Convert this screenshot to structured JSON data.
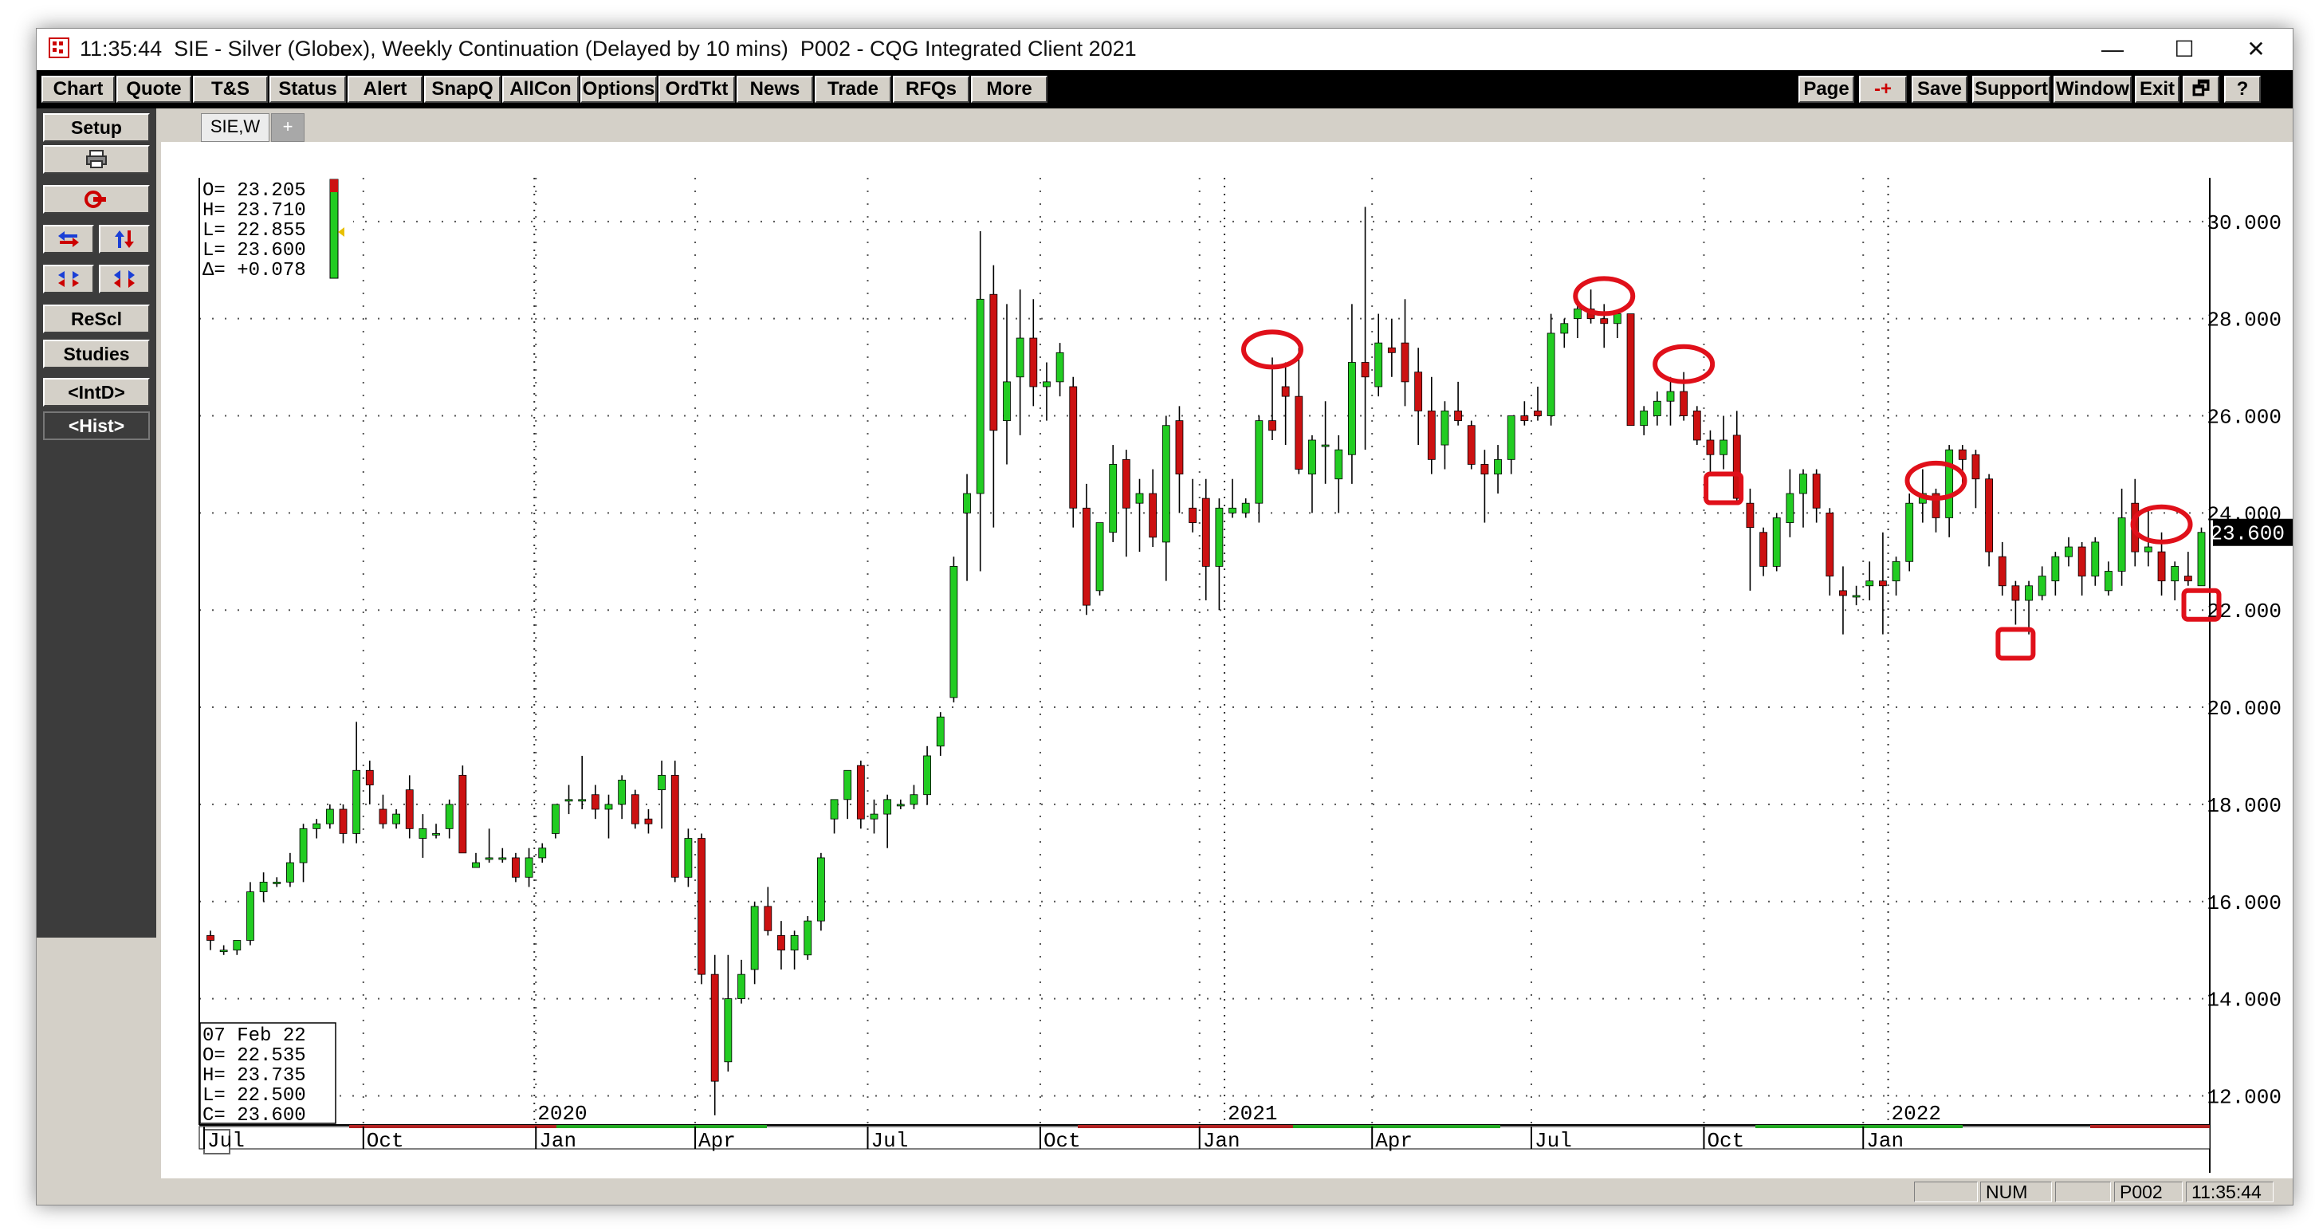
{
  "window": {
    "title": "11:35:44  SIE - Silver (Globex), Weekly Continuation (Delayed by 10 mins)  P002 - CQG Integrated Client 2021",
    "minimize": "—",
    "maximize": "☐",
    "close": "✕"
  },
  "menu_left": [
    "Chart",
    "Quote",
    "T&S",
    "Status",
    "Alert",
    "SnapQ",
    "AllCon",
    "Options",
    "OrdTkt",
    "News",
    "Trade",
    "RFQs",
    "More"
  ],
  "menu_right": [
    "Page",
    "-+",
    "Save",
    "Support",
    "Window",
    "Exit",
    "🗗",
    "?"
  ],
  "sidebar": {
    "setup": "Setup",
    "print_icon": "printer-icon",
    "close_chart_icon": "close-chart-icon",
    "rescale": "ReScl",
    "studies": "Studies",
    "intd": "<IntD>",
    "hist": "<Hist>"
  },
  "tabs": {
    "active": "SIE,W",
    "add": "+"
  },
  "colors": {
    "up": "#22cc22",
    "down": "#cc1111",
    "circle": "#e0101a",
    "grid": "#555555"
  },
  "readout_top": [
    "O=  23.205",
    "H=  23.710",
    "L=  22.855",
    "L=  23.600",
    "Δ= +0.078"
  ],
  "readout_bottom": [
    "07 Feb 22",
    "O=   22.535",
    "H=   23.735",
    "L=   22.500",
    "C=   23.600"
  ],
  "price_tag": "23.600",
  "status": {
    "num": "NUM",
    "page": "P002",
    "time": "11:35:44"
  },
  "chart_data": {
    "type": "candlestick",
    "title": "SIE - Silver (Globex), Weekly Continuation",
    "x_labels": [
      {
        "w": 0,
        "label": "Jul"
      },
      {
        "w": 12,
        "label": "Oct"
      },
      {
        "w": 25,
        "label": "Jan"
      },
      {
        "w": 37,
        "label": "Apr"
      },
      {
        "w": 50,
        "label": "Jul"
      },
      {
        "w": 63,
        "label": "Oct"
      },
      {
        "w": 75,
        "label": "Jan"
      },
      {
        "w": 88,
        "label": "Apr"
      },
      {
        "w": 100,
        "label": "Jul"
      },
      {
        "w": 113,
        "label": "Oct"
      },
      {
        "w": 125,
        "label": "Jan"
      }
    ],
    "year_labels": [
      {
        "w": 25,
        "label": "2020"
      },
      {
        "w": 77,
        "label": "2021"
      },
      {
        "w": 127,
        "label": "2022"
      }
    ],
    "y_ticks": [
      "12.000",
      "14.000",
      "16.000",
      "18.000",
      "20.000",
      "22.000",
      "24.000",
      "26.000",
      "28.000",
      "30.000"
    ],
    "ylim": [
      11.4,
      30.9
    ],
    "candles": [
      [
        15.3,
        15.4,
        15.0,
        15.2
      ],
      [
        15.0,
        15.1,
        14.9,
        15.0
      ],
      [
        15.0,
        15.2,
        14.9,
        15.2
      ],
      [
        15.2,
        16.4,
        15.1,
        16.2
      ],
      [
        16.2,
        16.6,
        16.0,
        16.4
      ],
      [
        16.4,
        16.5,
        16.3,
        16.4
      ],
      [
        16.4,
        17.0,
        16.3,
        16.8
      ],
      [
        16.8,
        17.6,
        16.4,
        17.5
      ],
      [
        17.5,
        17.7,
        17.3,
        17.6
      ],
      [
        17.6,
        18.0,
        17.5,
        17.9
      ],
      [
        17.9,
        18.0,
        17.2,
        17.4
      ],
      [
        17.4,
        19.7,
        17.2,
        18.7
      ],
      [
        18.7,
        18.9,
        18.0,
        18.4
      ],
      [
        17.9,
        18.2,
        17.5,
        17.6
      ],
      [
        17.6,
        17.9,
        17.5,
        17.8
      ],
      [
        18.3,
        18.6,
        17.3,
        17.5
      ],
      [
        17.3,
        17.8,
        16.9,
        17.5
      ],
      [
        17.4,
        17.6,
        17.3,
        17.4
      ],
      [
        17.5,
        18.1,
        17.3,
        18.0
      ],
      [
        18.6,
        18.8,
        17.0,
        17.0
      ],
      [
        16.7,
        17.0,
        16.7,
        16.8
      ],
      [
        16.9,
        17.5,
        16.8,
        16.9
      ],
      [
        16.9,
        17.1,
        16.8,
        16.9
      ],
      [
        16.9,
        17.0,
        16.4,
        16.5
      ],
      [
        16.5,
        17.1,
        16.3,
        16.9
      ],
      [
        16.9,
        17.2,
        16.8,
        17.1
      ],
      [
        17.4,
        18.0,
        17.3,
        18.0
      ],
      [
        18.1,
        18.4,
        17.8,
        18.1
      ],
      [
        18.1,
        19.0,
        17.9,
        18.1
      ],
      [
        18.2,
        18.4,
        17.7,
        17.9
      ],
      [
        17.9,
        18.2,
        17.3,
        18.0
      ],
      [
        18.0,
        18.6,
        17.7,
        18.5
      ],
      [
        18.2,
        18.3,
        17.5,
        17.6
      ],
      [
        17.7,
        17.9,
        17.4,
        17.6
      ],
      [
        18.3,
        18.9,
        17.5,
        18.6
      ],
      [
        18.6,
        18.9,
        16.4,
        16.5
      ],
      [
        16.5,
        17.5,
        16.3,
        17.3
      ],
      [
        17.3,
        17.4,
        14.3,
        14.5
      ],
      [
        14.5,
        14.9,
        11.6,
        12.3
      ],
      [
        12.7,
        14.9,
        12.5,
        14.0
      ],
      [
        14.0,
        14.8,
        13.9,
        14.5
      ],
      [
        14.6,
        16.0,
        14.3,
        15.9
      ],
      [
        15.9,
        16.3,
        15.3,
        15.4
      ],
      [
        15.3,
        15.6,
        14.6,
        15.0
      ],
      [
        15.0,
        15.4,
        14.6,
        15.3
      ],
      [
        14.9,
        15.7,
        14.8,
        15.6
      ],
      [
        15.6,
        17.0,
        15.4,
        16.9
      ],
      [
        17.7,
        18.0,
        17.4,
        18.1
      ],
      [
        18.1,
        18.7,
        17.7,
        18.7
      ],
      [
        18.8,
        18.9,
        17.5,
        17.7
      ],
      [
        17.7,
        18.1,
        17.4,
        17.8
      ],
      [
        17.8,
        18.2,
        17.1,
        18.1
      ],
      [
        18.0,
        18.1,
        17.9,
        18.0
      ],
      [
        18.0,
        18.4,
        17.9,
        18.2
      ],
      [
        18.2,
        19.2,
        18.0,
        19.0
      ],
      [
        19.2,
        19.9,
        19.0,
        19.8
      ],
      [
        20.2,
        23.1,
        20.1,
        22.9
      ],
      [
        24.0,
        24.8,
        22.6,
        24.4
      ],
      [
        24.4,
        29.8,
        22.8,
        28.4
      ],
      [
        28.5,
        29.1,
        23.7,
        25.7
      ],
      [
        25.9,
        28.3,
        25.0,
        26.7
      ],
      [
        26.8,
        28.6,
        25.6,
        27.6
      ],
      [
        27.6,
        28.4,
        26.2,
        26.6
      ],
      [
        26.6,
        27.1,
        25.9,
        26.7
      ],
      [
        26.7,
        27.5,
        26.4,
        27.3
      ],
      [
        26.6,
        26.8,
        23.7,
        24.1
      ],
      [
        24.1,
        24.6,
        21.9,
        22.1
      ],
      [
        22.4,
        23.5,
        22.3,
        23.8
      ],
      [
        23.6,
        25.4,
        23.4,
        25.0
      ],
      [
        25.1,
        25.3,
        23.1,
        24.1
      ],
      [
        24.2,
        24.7,
        23.2,
        24.4
      ],
      [
        24.4,
        24.9,
        23.3,
        23.5
      ],
      [
        23.4,
        26.0,
        22.6,
        25.8
      ],
      [
        25.9,
        26.2,
        24.0,
        24.8
      ],
      [
        24.1,
        24.7,
        23.6,
        23.8
      ],
      [
        24.3,
        24.7,
        22.2,
        22.9
      ],
      [
        22.9,
        24.3,
        22.0,
        24.1
      ],
      [
        24.0,
        24.7,
        23.9,
        24.1
      ],
      [
        24.0,
        24.3,
        23.9,
        24.2
      ],
      [
        24.2,
        26.0,
        23.8,
        25.9
      ],
      [
        25.9,
        27.2,
        25.5,
        25.7
      ],
      [
        26.6,
        27.1,
        25.4,
        26.4
      ],
      [
        26.4,
        27.4,
        24.8,
        24.9
      ],
      [
        24.8,
        25.6,
        24.0,
        25.5
      ],
      [
        25.4,
        26.3,
        24.6,
        25.4
      ],
      [
        24.7,
        25.6,
        24.0,
        25.3
      ],
      [
        25.2,
        28.3,
        24.6,
        27.1
      ],
      [
        27.1,
        30.3,
        25.3,
        26.8
      ],
      [
        26.6,
        28.1,
        26.4,
        27.5
      ],
      [
        27.4,
        28.0,
        26.8,
        27.3
      ],
      [
        27.5,
        28.4,
        26.2,
        26.7
      ],
      [
        26.9,
        27.4,
        25.4,
        26.1
      ],
      [
        26.1,
        26.8,
        24.8,
        25.1
      ],
      [
        25.4,
        26.3,
        24.9,
        26.1
      ],
      [
        26.1,
        26.7,
        25.8,
        25.9
      ],
      [
        25.8,
        25.9,
        24.9,
        25.0
      ],
      [
        25.0,
        25.3,
        23.8,
        24.8
      ],
      [
        24.8,
        25.4,
        24.4,
        25.1
      ],
      [
        25.1,
        26.0,
        24.8,
        26.0
      ],
      [
        26.0,
        26.3,
        25.8,
        25.9
      ],
      [
        26.1,
        26.6,
        25.9,
        26.0
      ],
      [
        26.0,
        28.1,
        25.8,
        27.7
      ],
      [
        27.7,
        28.0,
        27.4,
        27.9
      ],
      [
        28.0,
        28.4,
        27.6,
        28.2
      ],
      [
        28.2,
        28.6,
        27.9,
        28.0
      ],
      [
        28.0,
        28.3,
        27.4,
        27.9
      ],
      [
        27.9,
        28.0,
        27.6,
        28.1
      ],
      [
        28.1,
        28.1,
        26.0,
        25.8
      ],
      [
        25.8,
        26.2,
        25.6,
        26.1
      ],
      [
        26.0,
        26.5,
        25.8,
        26.3
      ],
      [
        26.3,
        26.8,
        25.8,
        26.5
      ],
      [
        26.5,
        26.9,
        25.9,
        26.0
      ],
      [
        26.1,
        26.2,
        25.4,
        25.5
      ],
      [
        25.5,
        25.7,
        24.8,
        25.2
      ],
      [
        25.2,
        26.0,
        24.9,
        25.5
      ],
      [
        25.6,
        26.1,
        24.2,
        24.3
      ],
      [
        24.2,
        24.5,
        22.4,
        23.7
      ],
      [
        23.6,
        23.7,
        22.7,
        22.9
      ],
      [
        22.9,
        24.0,
        22.8,
        23.9
      ],
      [
        23.8,
        24.9,
        23.5,
        24.4
      ],
      [
        24.4,
        24.9,
        23.7,
        24.8
      ],
      [
        24.8,
        24.9,
        23.8,
        24.1
      ],
      [
        24.0,
        24.1,
        22.3,
        22.7
      ],
      [
        22.4,
        22.9,
        21.5,
        22.3
      ],
      [
        22.3,
        22.5,
        22.1,
        22.3
      ],
      [
        22.5,
        23.0,
        22.2,
        22.6
      ],
      [
        22.6,
        23.6,
        21.5,
        22.5
      ],
      [
        22.6,
        23.1,
        22.3,
        23.0
      ],
      [
        23.0,
        24.4,
        22.8,
        24.2
      ],
      [
        24.2,
        24.9,
        23.8,
        24.4
      ],
      [
        24.4,
        24.5,
        23.6,
        23.9
      ],
      [
        23.9,
        25.4,
        23.5,
        25.3
      ],
      [
        25.3,
        25.4,
        24.6,
        25.1
      ],
      [
        25.2,
        25.3,
        24.1,
        24.7
      ],
      [
        24.7,
        24.8,
        22.9,
        23.2
      ],
      [
        23.1,
        23.4,
        22.3,
        22.5
      ],
      [
        22.5,
        22.6,
        21.7,
        22.2
      ],
      [
        22.2,
        22.6,
        21.5,
        22.5
      ],
      [
        22.3,
        22.9,
        22.2,
        22.7
      ],
      [
        22.6,
        23.2,
        22.3,
        23.1
      ],
      [
        23.1,
        23.5,
        22.9,
        23.3
      ],
      [
        23.3,
        23.4,
        22.3,
        22.7
      ],
      [
        22.7,
        23.5,
        22.5,
        23.4
      ],
      [
        22.4,
        23.0,
        22.3,
        22.8
      ],
      [
        22.8,
        24.5,
        22.5,
        23.9
      ],
      [
        24.2,
        24.7,
        22.9,
        23.2
      ],
      [
        23.2,
        24.1,
        22.9,
        23.3
      ],
      [
        23.2,
        23.6,
        22.3,
        22.6
      ],
      [
        22.6,
        23.0,
        22.2,
        22.9
      ],
      [
        22.7,
        23.2,
        22.5,
        22.6
      ],
      [
        22.5,
        23.7,
        22.5,
        23.6
      ]
    ],
    "circled_highs": [
      80,
      105,
      111,
      130,
      147
    ],
    "boxed_lows": [
      114,
      136,
      150
    ]
  }
}
